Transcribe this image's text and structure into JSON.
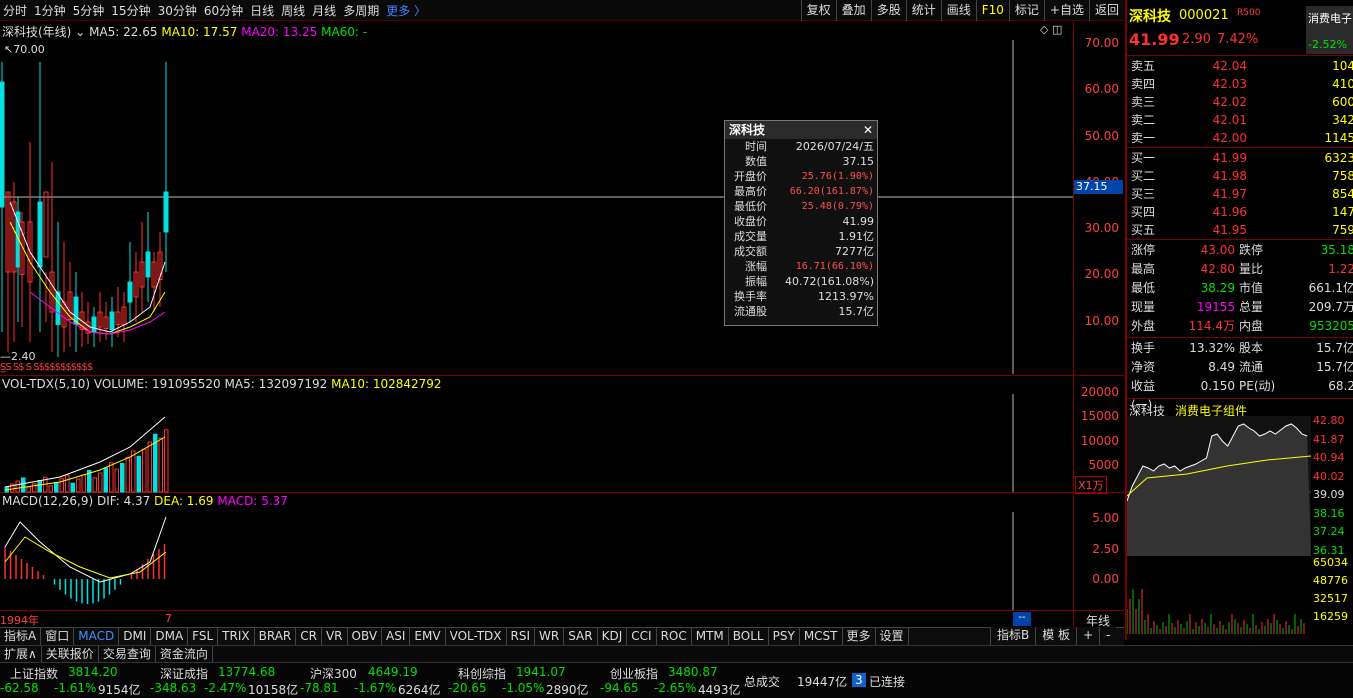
{
  "toolbar": {
    "periods": [
      "分时",
      "1分钟",
      "5分钟",
      "15分钟",
      "30分钟",
      "60分钟",
      "日线",
      "周线",
      "月线",
      "多周期",
      "更多 〉"
    ],
    "right_buttons": [
      "复权",
      "叠加",
      "多股",
      "统计",
      "画线",
      "F10",
      "标记",
      "+自选",
      "返回"
    ]
  },
  "main_chart": {
    "title": "深科技(年线)",
    "ma5": "MA5: 22.65",
    "ma10": "MA10: 17.57",
    "ma20": "MA20: 13.25",
    "ma60": "MA60: -",
    "high_label": "70.00",
    "low_label": "2.40",
    "y_ticks": [
      "70.00",
      "60.00",
      "50.00",
      "40.00",
      "30.00",
      "20.00",
      "10.00"
    ],
    "crosshair_value": "37.15"
  },
  "volume_chart": {
    "title": "VOL-TDX(5,10)",
    "volume": "VOLUME: 191095520",
    "ma5": "MA5: 132097192",
    "ma10": "MA10: 102842792",
    "y_ticks": [
      "20000",
      "15000",
      "10000",
      "5000"
    ],
    "unit": "X1万"
  },
  "macd_chart": {
    "title": "MACD(12,26,9)",
    "dif": "DIF: 4.37",
    "dea": "DEA: 1.69",
    "macd": "MACD: 5.37",
    "y_ticks": [
      "5.00",
      "2.50",
      "0.00"
    ]
  },
  "x_axis": {
    "start": "1994年",
    "mid": "7",
    "right": "年线"
  },
  "tooltip": {
    "title": "深科技",
    "rows": [
      {
        "k": "时间",
        "v": "2026/07/24/五"
      },
      {
        "k": "数值",
        "v": "37.15"
      },
      {
        "k": "开盘价",
        "v": "25.76(1.90%)"
      },
      {
        "k": "最高价",
        "v": "66.20(161.87%)"
      },
      {
        "k": "最低价",
        "v": "25.48(0.79%)"
      },
      {
        "k": "收盘价",
        "v": "41.99"
      },
      {
        "k": "成交量",
        "v": "1.91亿"
      },
      {
        "k": "成交额",
        "v": "7277亿"
      },
      {
        "k": "涨幅",
        "v": "16.71(66.10%)"
      },
      {
        "k": "振幅",
        "v": "40.72(161.08%)"
      },
      {
        "k": "换手率",
        "v": "1213.97%"
      },
      {
        "k": "流通股",
        "v": "15.7亿"
      }
    ]
  },
  "quote": {
    "name": "深科技",
    "code": "000021",
    "tag": "R500",
    "sector_short": "消费电子",
    "price": "41.99",
    "change": "2.90",
    "pct": "7.42%",
    "sector_pct": "-2.52%",
    "asks": [
      {
        "l": "卖五",
        "p": "42.04",
        "q": "104"
      },
      {
        "l": "卖四",
        "p": "42.03",
        "q": "410"
      },
      {
        "l": "卖三",
        "p": "42.02",
        "q": "600"
      },
      {
        "l": "卖二",
        "p": "42.01",
        "q": "342"
      },
      {
        "l": "卖一",
        "p": "42.00",
        "q": "1145"
      }
    ],
    "bids": [
      {
        "l": "买一",
        "p": "41.99",
        "q": "6323"
      },
      {
        "l": "买二",
        "p": "41.98",
        "q": "758"
      },
      {
        "l": "买三",
        "p": "41.97",
        "q": "854"
      },
      {
        "l": "买四",
        "p": "41.96",
        "q": "147"
      },
      {
        "l": "买五",
        "p": "41.95",
        "q": "759"
      }
    ],
    "stats1": [
      {
        "k1": "涨停",
        "v1": "43.00",
        "c1": "red",
        "k2": "跌停",
        "v2": "35.18",
        "c2": "grn"
      },
      {
        "k1": "最高",
        "v1": "42.80",
        "c1": "red",
        "k2": "量比",
        "v2": "1.22",
        "c2": "red"
      },
      {
        "k1": "最低",
        "v1": "38.29",
        "c1": "grn",
        "k2": "市值",
        "v2": "661.1亿",
        "c2": "wht"
      },
      {
        "k1": "现量",
        "v1": "19155",
        "c1": "mag",
        "k2": "总量",
        "v2": "209.7万",
        "c2": "wht"
      },
      {
        "k1": "外盘",
        "v1": "114.4万",
        "c1": "red",
        "k2": "内盘",
        "v2": "953205",
        "c2": "grn"
      }
    ],
    "stats2": [
      {
        "k1": "换手",
        "v1": "13.32%",
        "c1": "wht",
        "k2": "股本",
        "v2": "15.7亿",
        "c2": "wht"
      },
      {
        "k1": "净资",
        "v1": "8.49",
        "c1": "wht",
        "k2": "流通",
        "v2": "15.7亿",
        "c2": "wht"
      },
      {
        "k1": "收益(一)",
        "v1": "0.150",
        "c1": "wht",
        "k2": "PE(动)",
        "v2": "68.2",
        "c2": "wht"
      }
    ],
    "mini_title": "深科技",
    "mini_sector": "消费电子组件",
    "mini_ticks": [
      "42.80",
      "41.87",
      "40.94",
      "40.02",
      "39.09",
      "38.16",
      "37.24",
      "36.31"
    ],
    "mini_vol_ticks": [
      "65034",
      "48776",
      "32517",
      "16259"
    ]
  },
  "indicator_tabs": [
    "指标A",
    "窗口",
    "MACD",
    "DMI",
    "DMA",
    "FSL",
    "TRIX",
    "BRAR",
    "CR",
    "VR",
    "OBV",
    "ASI",
    "EMV",
    "VOL-TDX",
    "RSI",
    "WR",
    "SAR",
    "KDJ",
    "CCI",
    "ROC",
    "MTM",
    "BOLL",
    "PSY",
    "MCST",
    "更多",
    "设置"
  ],
  "indicator_right": [
    "指标B",
    "模 板",
    "+",
    "-"
  ],
  "bottom_tabs": [
    "扩展∧",
    "关联报价",
    "交易查询",
    "资金流向"
  ],
  "indices": [
    {
      "name": "上证指数",
      "val": "3814.20",
      "chg": "-62.58",
      "pct": "-1.61%",
      "amt": "9154亿"
    },
    {
      "name": "深证成指",
      "val": "13774.68",
      "chg": "-348.63",
      "pct": "-2.47%",
      "amt": "10158亿"
    },
    {
      "name": "沪深300",
      "val": "4649.19",
      "chg": "-78.81",
      "pct": "-1.67%",
      "amt": "6264亿"
    },
    {
      "name": "科创综指",
      "val": "1941.07",
      "chg": "-20.65",
      "pct": "-1.05%",
      "amt": "2890亿"
    },
    {
      "name": "创业板指",
      "val": "3480.87",
      "chg": "-94.65",
      "pct": "-2.65%",
      "amt": "4493亿"
    }
  ],
  "total": {
    "label": "总成交",
    "value": "19447亿",
    "conn_count": "3",
    "conn": "已连接"
  },
  "colors": {
    "up": "#ff3030",
    "down": "#00e0e0",
    "ma5": "#ffffff",
    "ma10": "#ffff00",
    "ma20": "#ff00ff",
    "border": "#7a0000"
  }
}
